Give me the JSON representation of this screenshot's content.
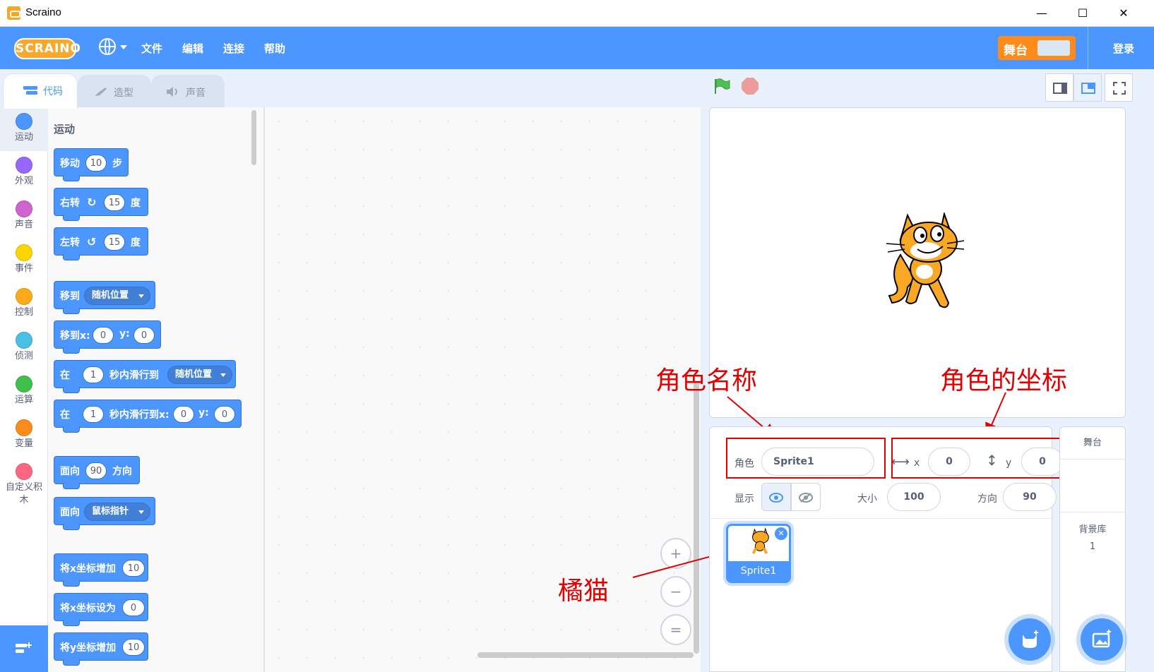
{
  "window": {
    "title": "Scraino",
    "controls": [
      "—",
      "☐",
      "✕"
    ]
  },
  "menubar": {
    "logo_text": "SCRAINO",
    "items": [
      "文件",
      "编辑",
      "连接",
      "帮助"
    ],
    "stage_toggle_label": "舞台",
    "login_label": "登录"
  },
  "tabs": [
    {
      "label": "代码",
      "icon": "code-icon",
      "active": true
    },
    {
      "label": "造型",
      "icon": "brush-icon",
      "active": false
    },
    {
      "label": "声音",
      "icon": "speaker-icon",
      "active": false
    }
  ],
  "categories": [
    {
      "label": "运动",
      "color": "#4c97ff"
    },
    {
      "label": "外观",
      "color": "#9966ff"
    },
    {
      "label": "声音",
      "color": "#cf63cf"
    },
    {
      "label": "事件",
      "color": "#ffd500"
    },
    {
      "label": "控制",
      "color": "#ffab19"
    },
    {
      "label": "侦测",
      "color": "#4cbfe6"
    },
    {
      "label": "运算",
      "color": "#40bf4a"
    },
    {
      "label": "变量",
      "color": "#ff8c1a"
    },
    {
      "label": "自定义积木",
      "color": "#ff6680"
    }
  ],
  "palette": {
    "heading": "运动",
    "blocks": {
      "move": {
        "a": "移动",
        "v": "10",
        "b": "步"
      },
      "turn_right": {
        "a": "右转",
        "v": "15",
        "b": "度"
      },
      "turn_left": {
        "a": "左转",
        "v": "15",
        "b": "度"
      },
      "goto": {
        "a": "移到",
        "dd": "随机位置"
      },
      "goto_xy": {
        "a": "移到x:",
        "x": "0",
        "y_label": "y:",
        "y": "0"
      },
      "glide": {
        "a": "在",
        "v": "1",
        "b": "秒内滑行到",
        "dd": "随机位置"
      },
      "glide_xy": {
        "a": "在",
        "v": "1",
        "b": "秒内滑行到x:",
        "x": "0",
        "y_label": "y:",
        "y": "0"
      },
      "point_dir": {
        "a": "面向",
        "v": "90",
        "b": "方向"
      },
      "point_towards": {
        "a": "面向",
        "dd": "鼠标指针"
      },
      "change_x": {
        "a": "将x坐标增加",
        "v": "10"
      },
      "set_x": {
        "a": "将x坐标设为",
        "v": "0"
      },
      "change_y": {
        "a": "将y坐标增加",
        "v": "10"
      }
    }
  },
  "zoom": {
    "in": "+",
    "out": "−",
    "reset": "="
  },
  "annotations": {
    "sprite_name": "角色名称",
    "sprite_coords": "角色的坐标",
    "cat": "橘猫"
  },
  "sprite_info": {
    "sprite_label": "角色",
    "sprite_name": "Sprite1",
    "x_label": "x",
    "x_value": "0",
    "y_label": "y",
    "y_value": "0",
    "show_label": "显示",
    "size_label": "大小",
    "size_value": "100",
    "direction_label": "方向",
    "direction_value": "90"
  },
  "sprites": [
    {
      "name": "Sprite1",
      "selected": true
    }
  ],
  "stage_panel": {
    "title": "舞台",
    "backdrop_label": "背景库",
    "backdrop_count": "1"
  },
  "colors": {
    "accent": "#4c97ff",
    "stage_toggle": "#ff8c1a",
    "annotation": "#e30000"
  }
}
